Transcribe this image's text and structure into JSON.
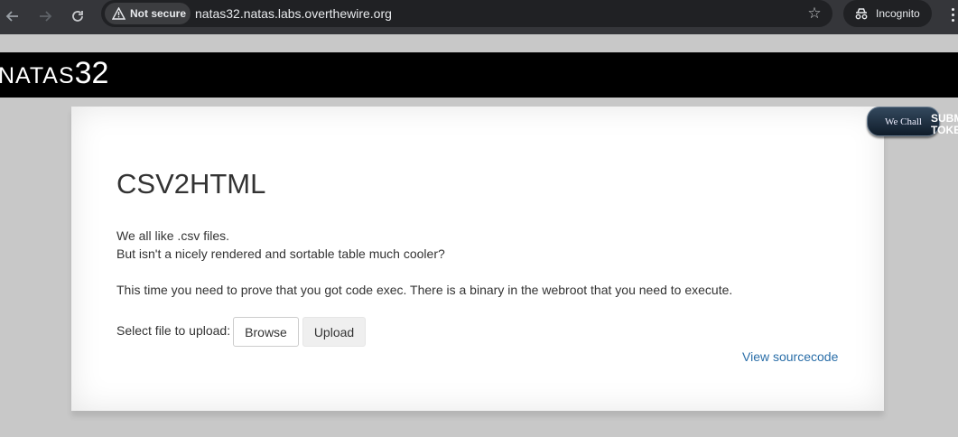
{
  "browser": {
    "security_label": "Not secure",
    "url": "natas32.natas.labs.overthewire.org",
    "incognito_label": "Incognito"
  },
  "banner": {
    "title_prefix": "NATAS",
    "title_number": "32"
  },
  "wechall": {
    "badge_text": "We Chall",
    "side_line1": "SUBM",
    "side_line2": "TOKE"
  },
  "main": {
    "heading": "CSV2HTML",
    "line1": "We all like .csv files.",
    "line2": "But isn't a nicely rendered and sortable table much cooler?",
    "line3": "This time you need to prove that you got code exec. There is a binary in the webroot that you need to execute.",
    "upload_label": "Select file to upload:",
    "browse_label": "Browse",
    "upload_button": "Upload",
    "view_source": "View sourcecode"
  }
}
